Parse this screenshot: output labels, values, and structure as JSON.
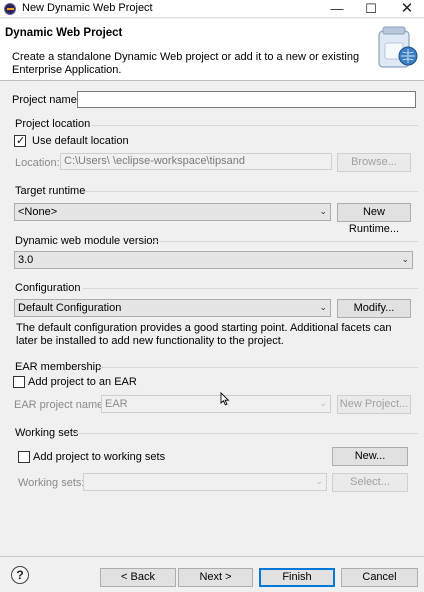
{
  "window": {
    "title": "New Dynamic Web Project",
    "minimize_icon": "minimize-icon",
    "maximize_icon": "maximize-icon",
    "close_icon": "close-icon"
  },
  "header": {
    "title": "Dynamic Web Project",
    "description": "Create a standalone Dynamic Web project or add it to a new or existing Enterprise Application."
  },
  "project_name": {
    "label": "Project name:",
    "value": ""
  },
  "project_location": {
    "group_label": "Project location",
    "use_default_label": "Use default location",
    "use_default_checked": true,
    "location_label": "Location:",
    "location_value": "C:\\Users\\        \\eclipse-workspace\\tipsand",
    "browse_label": "Browse..."
  },
  "target_runtime": {
    "group_label": "Target runtime",
    "selected": "<None>",
    "new_runtime_label": "New Runtime..."
  },
  "module_version": {
    "group_label": "Dynamic web module version",
    "selected": "3.0"
  },
  "configuration": {
    "group_label": "Configuration",
    "selected": "Default Configuration",
    "modify_label": "Modify...",
    "description": "The default configuration provides a good starting point. Additional facets can later be installed to add new functionality to the project."
  },
  "ear_membership": {
    "group_label": "EAR membership",
    "add_label": "Add project to an EAR",
    "add_checked": false,
    "ear_name_label": "EAR project name:",
    "ear_name_value": "EAR",
    "new_project_label": "New Project..."
  },
  "working_sets": {
    "group_label": "Working sets",
    "add_label": "Add project to working sets",
    "add_checked": false,
    "new_label": "New...",
    "sets_label": "Working sets:",
    "sets_value": "",
    "select_label": "Select..."
  },
  "footer": {
    "help_glyph": "?",
    "back_label": "< Back",
    "next_label": "Next >",
    "finish_label": "Finish",
    "cancel_label": "Cancel"
  },
  "colors": {
    "accent": "#0078d7",
    "eclipse_icon": "#2c2255",
    "eclipse_stripe": "#f6a41c"
  },
  "icons": [
    "eclipse-app-icon",
    "wizard-banner-jar-icon",
    "help-icon",
    "mouse-cursor-icon"
  ]
}
